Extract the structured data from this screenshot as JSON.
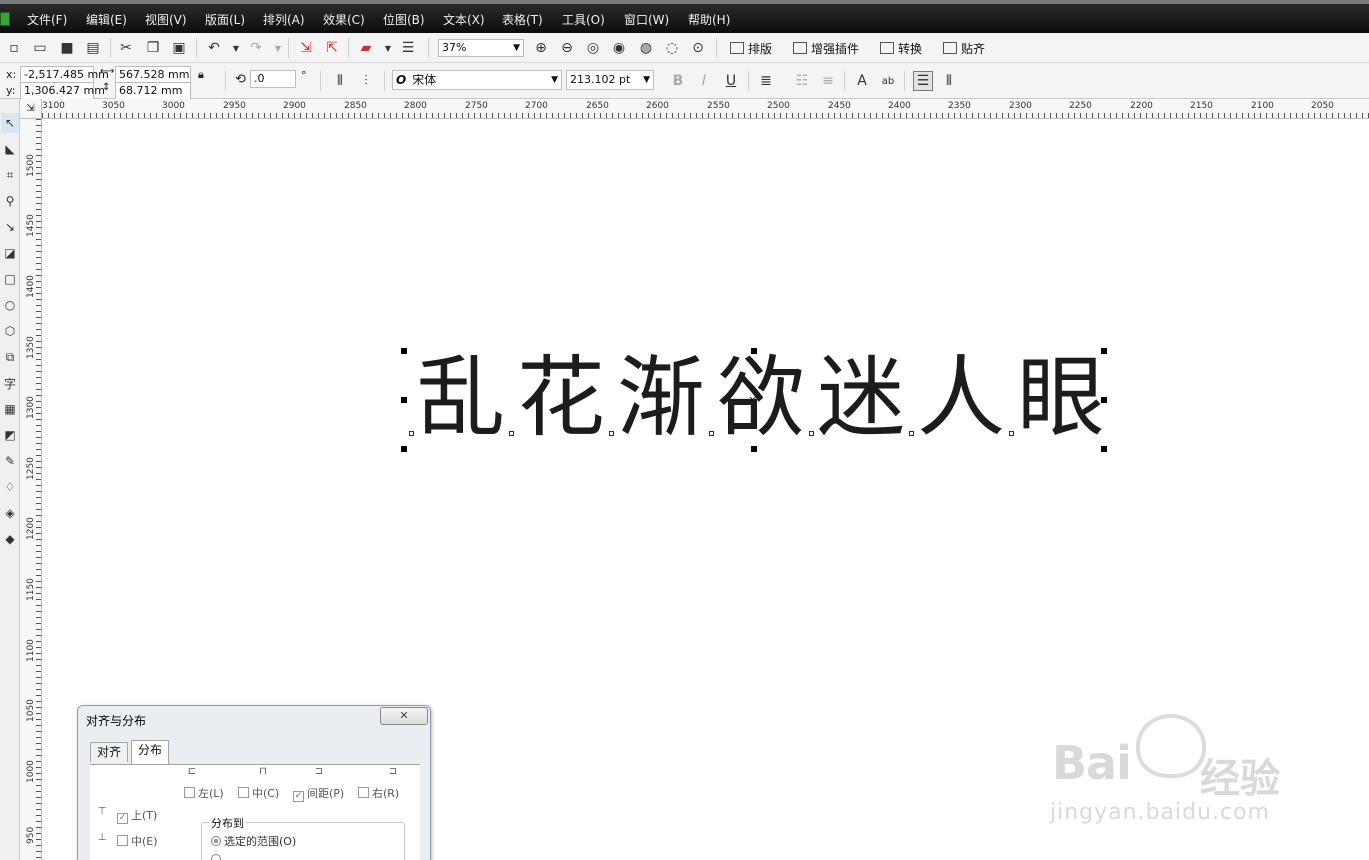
{
  "menu": [
    "文件(F)",
    "编辑(E)",
    "视图(V)",
    "版面(L)",
    "排列(A)",
    "效果(C)",
    "位图(B)",
    "文本(X)",
    "表格(T)",
    "工具(O)",
    "窗口(W)",
    "帮助(H)"
  ],
  "toolbar": {
    "zoom": "37%",
    "layout_label": "排版",
    "plugin_label": "增强插件",
    "convert_label": "转换",
    "snap_label": "贴齐"
  },
  "properties": {
    "x_label": "x:",
    "y_label": "y:",
    "x": "-2,517.485 mm",
    "y": "1,306.427 mm",
    "width": "567.528 mm",
    "height": "68.712 mm",
    "rotation": ".0",
    "degree": "°",
    "font": "宋体",
    "font_size": "213.102 pt",
    "font_icon": "O"
  },
  "ruler_h": [
    "3100",
    "3050",
    "3000",
    "2950",
    "2900",
    "2850",
    "2800",
    "2750",
    "2700",
    "2650",
    "2600",
    "2550",
    "2500",
    "2450",
    "2400",
    "2350",
    "2300",
    "2250",
    "2200",
    "2150",
    "2100",
    "2050"
  ],
  "ruler_v": [
    "1500",
    "1450",
    "1400",
    "1350",
    "1300",
    "1250",
    "1200",
    "1150",
    "1100",
    "1050",
    "1000",
    "950"
  ],
  "canvas_text": [
    "乱",
    "花",
    "渐",
    "欲",
    "迷",
    "人",
    "眼"
  ],
  "dialog": {
    "title": "对齐与分布",
    "tabs": [
      "对齐",
      "分布"
    ],
    "active_tab": "分布",
    "h_options": [
      {
        "label": "左(L)",
        "checked": false
      },
      {
        "label": "中(C)",
        "checked": false
      },
      {
        "label": "间距(P)",
        "checked": true
      },
      {
        "label": "右(R)",
        "checked": false
      }
    ],
    "v_options": [
      {
        "label": "上(T)",
        "checked": true
      },
      {
        "label": "中(E)",
        "checked": false
      }
    ],
    "distribute_to": "分布到",
    "range_selected": "选定的范围(O)"
  },
  "watermark": {
    "brand": "Bai",
    "brand_cn": "经验",
    "url": "jingyan.baidu.com"
  }
}
